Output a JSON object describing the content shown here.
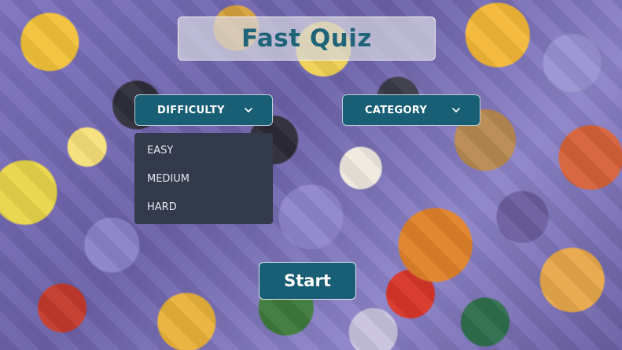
{
  "app": {
    "title": "Fast Quiz"
  },
  "difficulty": {
    "label": "DIFFICULTY",
    "icon": "chevron-down-icon",
    "options": [
      "EASY",
      "MEDIUM",
      "HARD"
    ]
  },
  "category": {
    "label": "CATEGORY",
    "icon": "chevron-down-icon"
  },
  "start": {
    "label": "Start"
  },
  "colors": {
    "primary": "#185e75",
    "title_text": "#1f6479",
    "dropdown_bg": "#323a4c"
  }
}
